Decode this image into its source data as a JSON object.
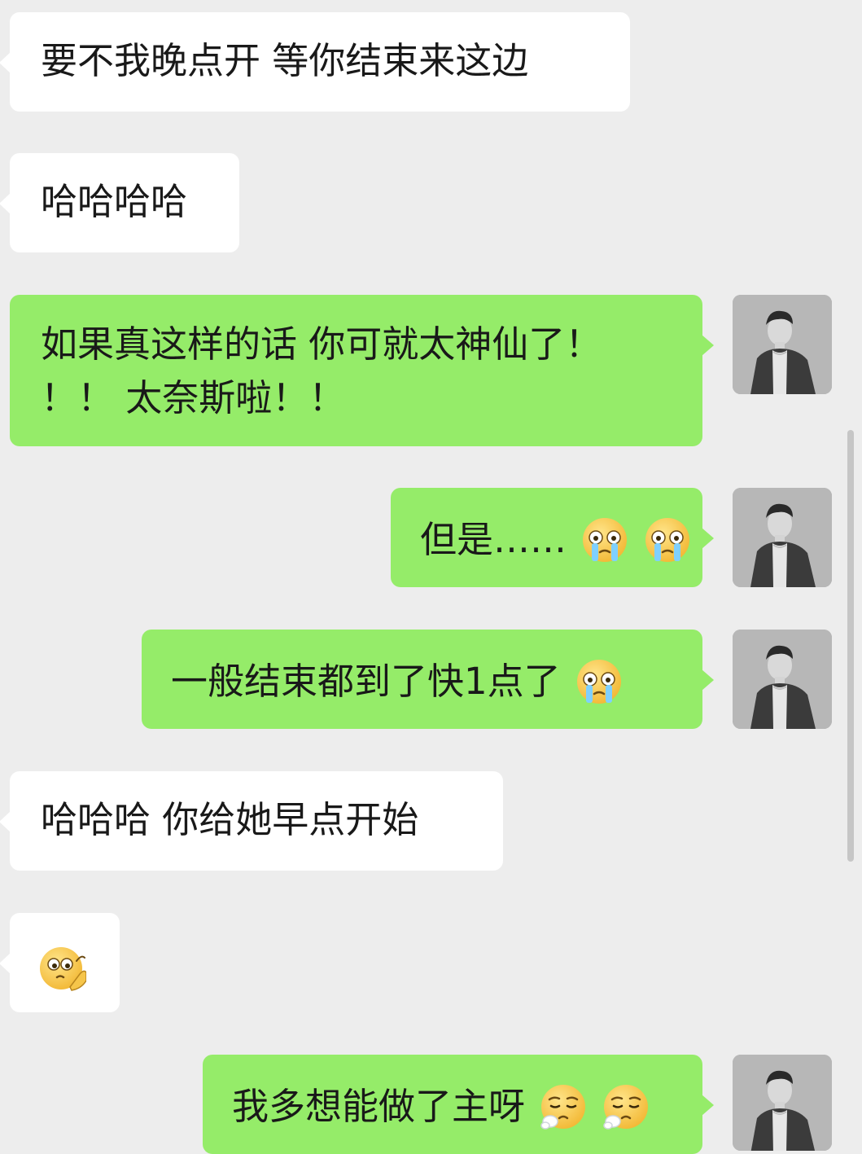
{
  "conversation": {
    "messages": [
      {
        "text": "要不我晚点开 等你结束来这边"
      },
      {
        "text": "哈哈哈哈"
      },
      {
        "line1": "如果真这样的话 你可就太神仙了！",
        "line2": "！！ 太奈斯啦！！"
      },
      {
        "text": "但是……",
        "emojis": [
          "crying-emoji",
          "crying-emoji"
        ]
      },
      {
        "text": "一般结束都到了快1点了",
        "emojis": [
          "crying-emoji"
        ]
      },
      {
        "text": "哈哈哈 你给她早点开始"
      },
      {
        "emojis": [
          "thinking-emoji"
        ]
      },
      {
        "text": "我多想能做了主呀",
        "emojis": [
          "sigh-emoji",
          "sigh-emoji"
        ]
      }
    ]
  },
  "colors": {
    "background": "#ededed",
    "incoming_bubble": "#ffffff",
    "outgoing_bubble": "#95ec69",
    "text": "#191919"
  }
}
